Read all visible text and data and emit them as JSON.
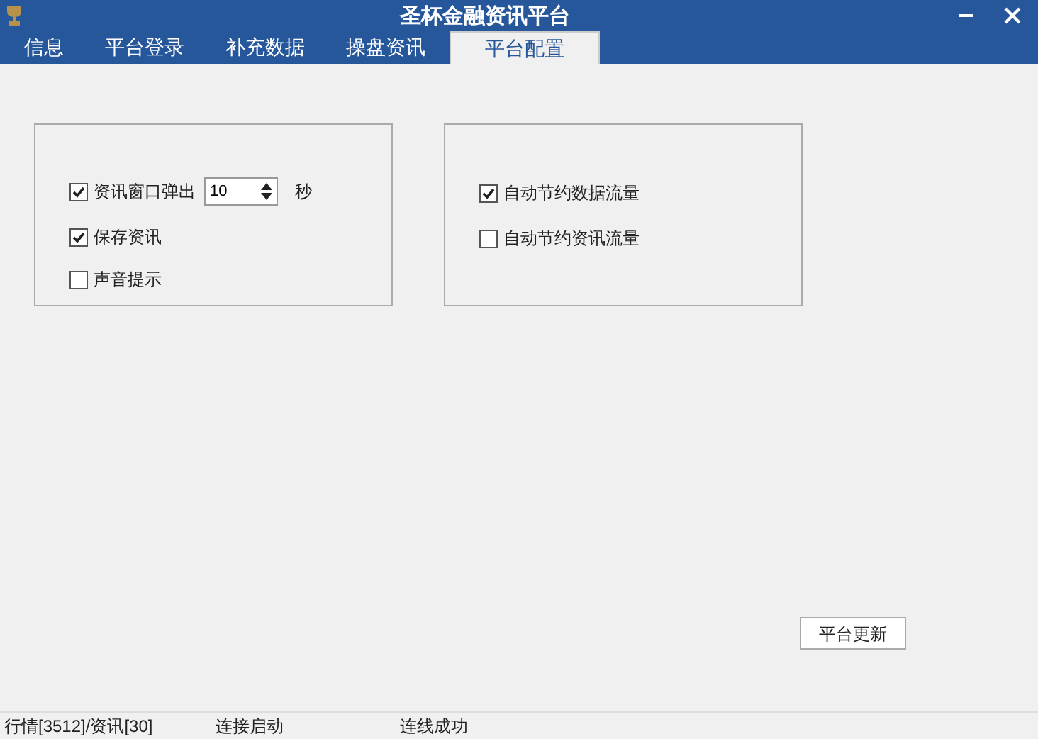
{
  "window": {
    "title": "圣杯金融资讯平台"
  },
  "tabs": [
    {
      "label": "信息",
      "selected": false
    },
    {
      "label": "平台登录",
      "selected": false
    },
    {
      "label": "补充数据",
      "selected": false
    },
    {
      "label": "操盘资讯",
      "selected": false
    },
    {
      "label": "平台配置",
      "selected": true
    }
  ],
  "left_group": {
    "options": [
      {
        "kind": "spinner",
        "label": "资讯窗口弹出",
        "checked": true,
        "value": "10",
        "unit": "秒"
      },
      {
        "kind": "checkbox",
        "label": "保存资讯",
        "checked": true
      },
      {
        "kind": "checkbox",
        "label": "声音提示",
        "checked": false
      }
    ]
  },
  "right_group": {
    "options": [
      {
        "kind": "checkbox",
        "label": "自动节约数据流量",
        "checked": true
      },
      {
        "kind": "checkbox",
        "label": "自动节约资讯流量",
        "checked": false
      }
    ]
  },
  "update_button": "平台更新",
  "status_bar": [
    "行情[3512]/资讯[30]",
    "连接启动",
    "连线成功"
  ]
}
